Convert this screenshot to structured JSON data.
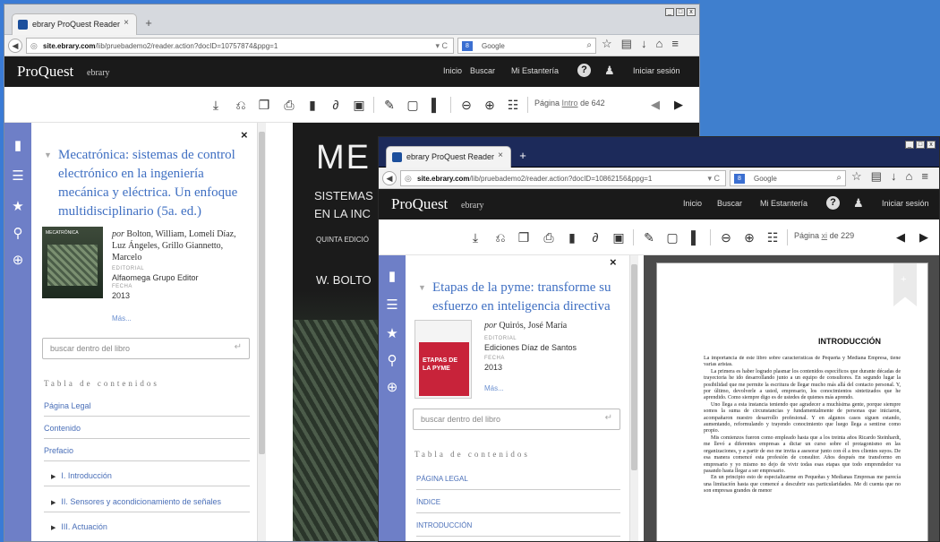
{
  "back_window": {
    "tab_title": "ebrary ProQuest Reader",
    "url_host": "site.ebrary.com",
    "url_path": "/lib/pruebademo2/reader.action?docID=10757874&ppg=1",
    "search_engine": "Google",
    "brand": "ProQuest",
    "brand_sub": "ebrary",
    "nav": [
      "Inicio",
      "Buscar",
      "Mi Estantería",
      "Iniciar sesión"
    ],
    "page_prefix": "Página",
    "page_current": "Intro",
    "page_total": "de 642",
    "book_title": "Mecatrónica: sistemas de control electrónico en la ingeniería mecánica y eléctrica. Un enfoque multidisciplinario (5a. ed.)",
    "by_prefix": "por",
    "authors": "Bolton, William, Lomelí Díaz, Luz Ángeles, Grillo Giannetto, Marcelo",
    "publisher_label": "EDITORIAL",
    "publisher": "Alfaomega Grupo Editor",
    "date_label": "FECHA",
    "date": "2013",
    "more": "Más...",
    "search_placeholder": "buscar dentro del libro",
    "toc_heading": "Tabla de contenidos",
    "toc": [
      "Página Legal",
      "Contenido",
      "Prefacio",
      "I. Introducción",
      "II. Sensores y acondicionamiento de señales",
      "III. Actuación"
    ],
    "cover_title": "ME",
    "cover_sub_1": "SISTEMAS",
    "cover_sub_2": "EN LA INC",
    "cover_edition": "QUINTA EDICIÓ",
    "cover_author": "W. BOLTO",
    "thumb_text": "MECATRÓNICA"
  },
  "front_window": {
    "tab_title": "ebrary ProQuest Reader",
    "url_host": "site.ebrary.com",
    "url_path": "/lib/pruebademo2/reader.action?docID=10862156&ppg=1",
    "search_engine": "Google",
    "brand": "ProQuest",
    "brand_sub": "ebrary",
    "nav": [
      "Inicio",
      "Buscar",
      "Mi Estantería",
      "Iniciar sesión"
    ],
    "page_prefix": "Página",
    "page_current": "xi",
    "page_total": "de 229",
    "book_title": "Etapas de la pyme: transforme su esfuerzo en inteligencia directiva",
    "by_prefix": "por",
    "authors": "Quirós, José María",
    "publisher_label": "EDITORIAL",
    "publisher": "Ediciones Díaz de Santos",
    "date_label": "FECHA",
    "date": "2013",
    "more": "Más...",
    "search_placeholder": "buscar dentro del libro",
    "toc_heading": "Tabla de contenidos",
    "toc": [
      "PÁGINA LEGAL",
      "ÍNDICE",
      "INTRODUCCIÓN"
    ],
    "cover_text": "ETAPAS DE LA PYME",
    "page_heading": "INTRODUCCIÓN",
    "page_paragraphs": [
      "La importancia de este libro sobre características de Pequeña y Mediana Empresa, tiene varias aristas.",
      "La primera es haber logrado plasmar los contenidos específicos que durante décadas de trayectoria he ido desarrollando junto a un equipo de consultores. En segundo lugar la posibilidad que me permite la escritura de llegar mucho más allá del contacto personal. Y, por último, devolverle a usted, empresario, los conocimientos sintetizados que he aprendido. Como siempre digo es de ustedes de quienes más aprendo.",
      "Uno llega a esta instancia teniendo que agradecer a muchísima gente, porque siempre somos la suma de circunstancias y fundamentalmente de personas que iniciaron, acompañaron nuestro desarrollo profesional. Y en algunos casos siguen estando, aumentando, reformulando y trayendo conocimiento que luego llega a sentirse como propio.",
      "Mis comienzos fueron como empleado hasta que a los treinta años Ricardo Steinhardt, me llevó a diferentes empresas a dictar un curso sobre el protagonismo en las organizaciones, y a partir de eso me invita a asesorar junto con él a tres clientes suyos. De esa manera comencé esta profesión de consultor. Años después me transformo en empresario y yo mismo no dejo de vivir todas esas etapas que todo emprendedor va pasando hasta llegar a ser empresario.",
      "En un principio esto de especializarme en Pequeñas y Medianas Empresas me parecía una limitación hasta que comencé a descubrir sus particularidades. Me di cuenta que no son empresas grandes de menor"
    ]
  }
}
